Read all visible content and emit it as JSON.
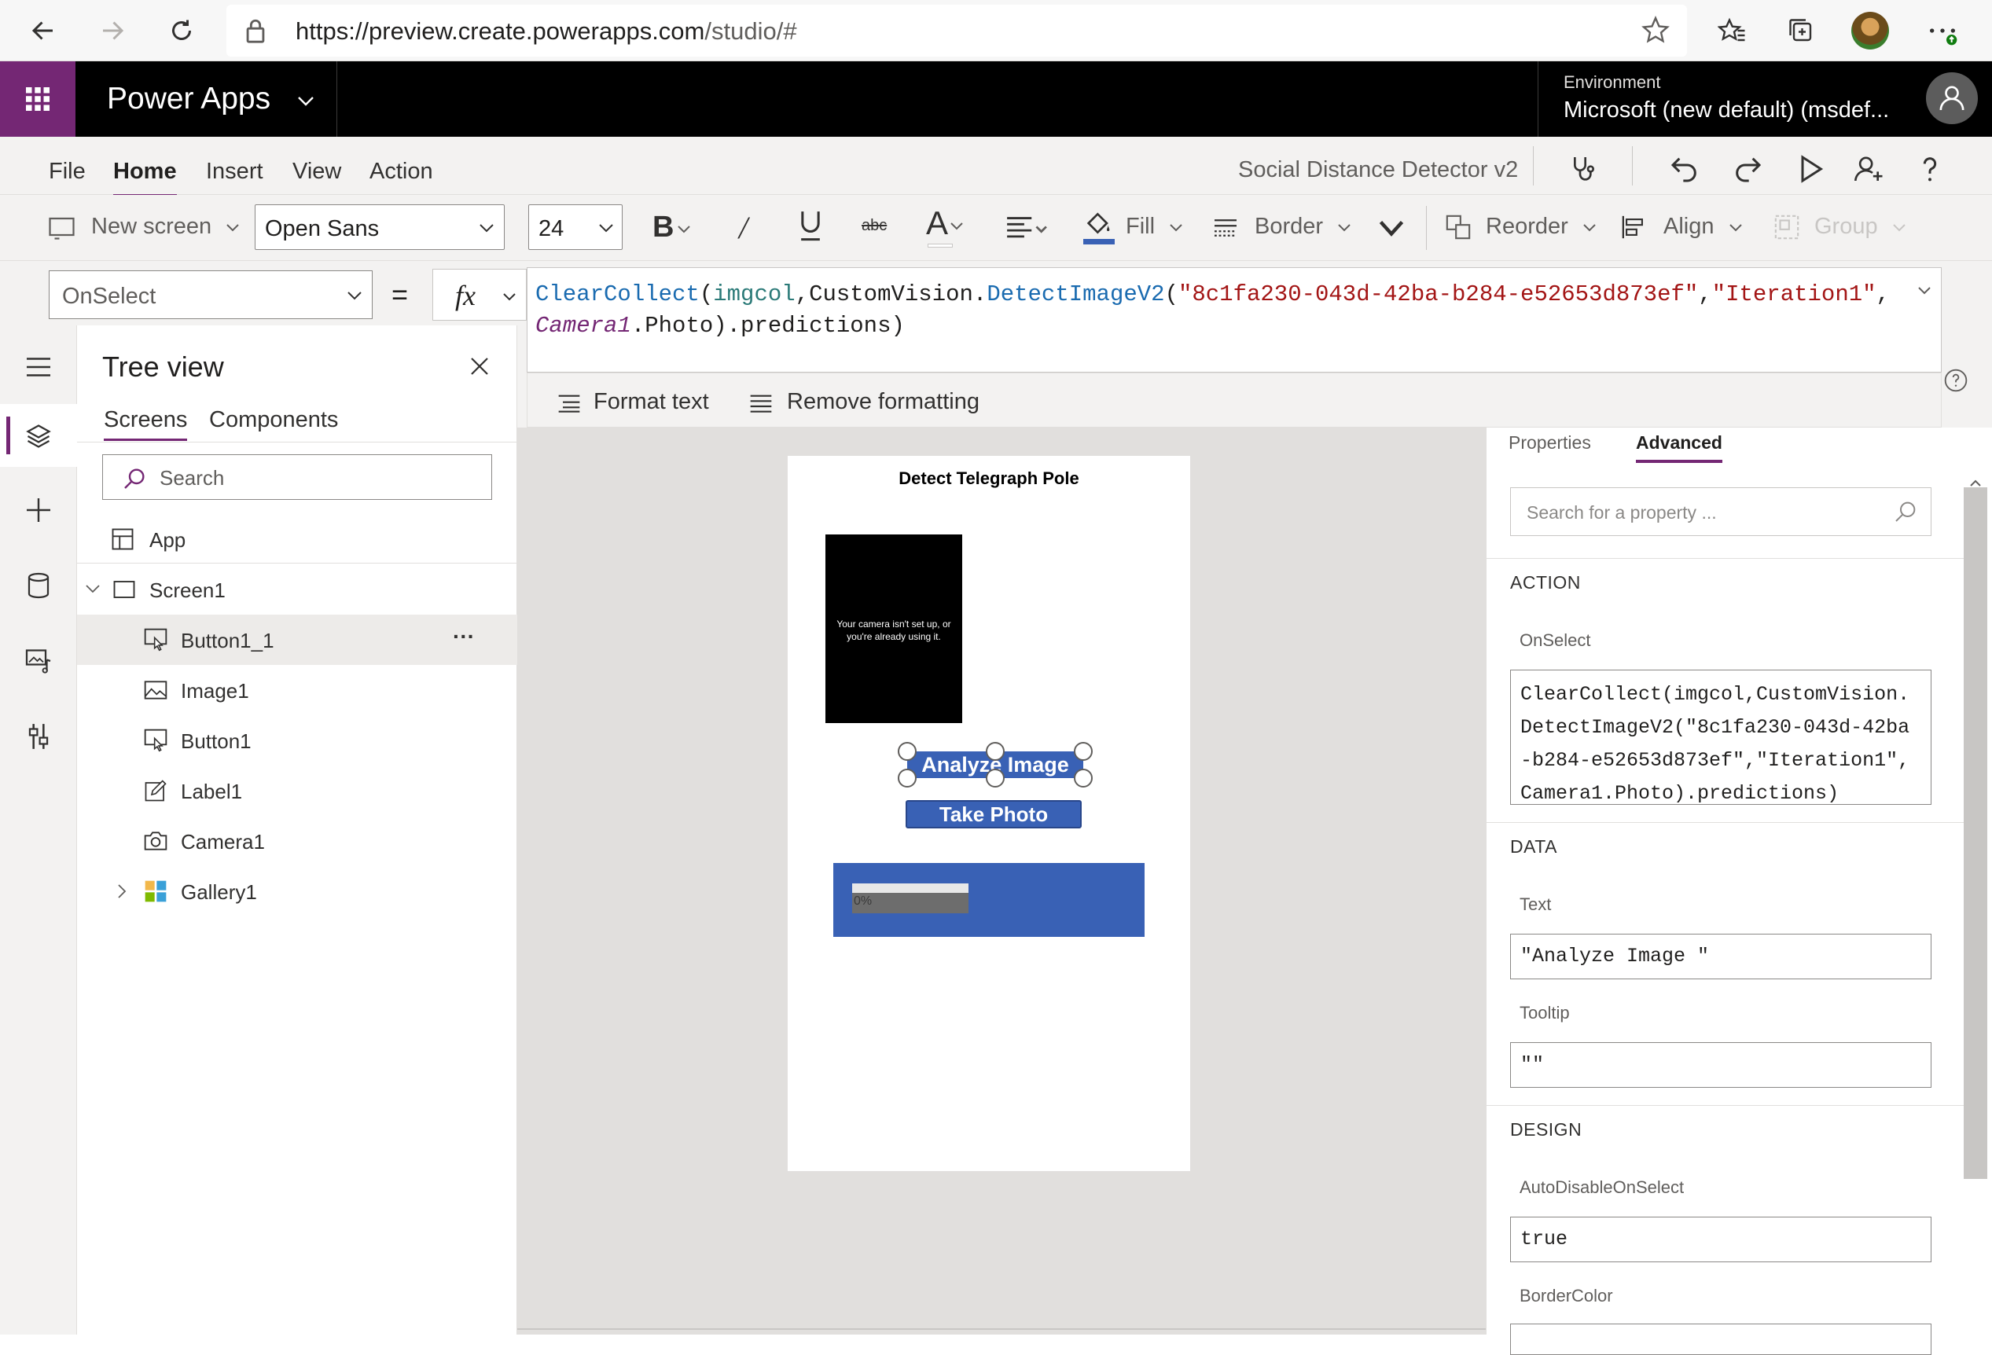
{
  "browser": {
    "url_main": "https://preview.create.powerapps.com",
    "url_path": "/studio/#"
  },
  "header": {
    "app_name": "Power Apps",
    "env_label": "Environment",
    "env_name": "Microsoft (new default) (msdef..."
  },
  "menu": {
    "items": [
      "File",
      "Home",
      "Insert",
      "View",
      "Action"
    ],
    "active": "Home",
    "app_title": "Social Distance Detector v2"
  },
  "toolbar": {
    "new_screen": "New screen",
    "font": "Open Sans",
    "font_size": "24",
    "fill": "Fill",
    "border": "Border",
    "reorder": "Reorder",
    "align": "Align",
    "group": "Group"
  },
  "formula": {
    "property": "OnSelect",
    "equals": "=",
    "fx": "fx",
    "line1_a": "ClearCollect",
    "line1_b": "(",
    "line1_c": "imgcol",
    "line1_d": ",CustomVision.",
    "line1_e": "DetectImageV2",
    "line1_f": "(",
    "line1_g": "\"8c1fa230-043d-42ba-b284-e52653d873ef\"",
    "line1_h": ",",
    "line1_i": "\"Iteration1\"",
    "line1_j": ",",
    "line2_a": "Camera1",
    "line2_b": ".Photo).predictions)",
    "format_text": "Format text",
    "remove_formatting": "Remove formatting"
  },
  "tree": {
    "title": "Tree view",
    "tabs": [
      "Screens",
      "Components"
    ],
    "search_placeholder": "Search",
    "items": {
      "app": "App",
      "screen1": "Screen1",
      "button1_1": "Button1_1",
      "image1": "Image1",
      "button1": "Button1",
      "label1": "Label1",
      "camera1": "Camera1",
      "gallery1": "Gallery1"
    },
    "more": "···"
  },
  "canvas": {
    "screen_title": "Detect Telegraph Pole",
    "camera_msg": "Your camera isn't set up, or you're already using it.",
    "analyze_label": "Analyze Image",
    "take_photo_label": "Take Photo",
    "progress_label": "0%",
    "progress_value": 0
  },
  "properties": {
    "tabs": [
      "Properties",
      "Advanced"
    ],
    "active_tab": "Advanced",
    "search_placeholder": "Search for a property ...",
    "action_header": "ACTION",
    "onselect_label": "OnSelect",
    "onselect_value": "ClearCollect(imgcol,CustomVision.DetectImageV2(\"8c1fa230-043d-42ba-b284-e52653d873ef\",\"Iteration1\",Camera1.Photo).predictions)",
    "data_header": "DATA",
    "text_label": "Text",
    "text_value": "\"Analyze Image \"",
    "tooltip_label": "Tooltip",
    "tooltip_value": "\"\"",
    "design_header": "DESIGN",
    "autodisable_label": "AutoDisableOnSelect",
    "autodisable_value": "true",
    "bordercolor_label": "BorderColor"
  },
  "colors": {
    "accent": "#742774",
    "button_blue": "#3961b5",
    "header_black": "#000000"
  }
}
